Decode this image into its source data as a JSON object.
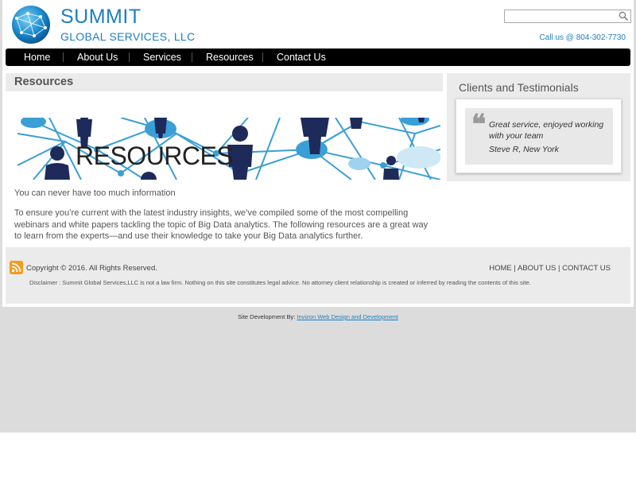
{
  "header": {
    "logo_title": "SUMMIT",
    "logo_subtitle": "GLOBAL SERVICES, LLC",
    "search_placeholder": "",
    "call_us": "Call us @ 804-302-7730"
  },
  "nav": {
    "items": [
      "Home",
      "About Us",
      "Services",
      "Resources",
      "Contact Us"
    ]
  },
  "main": {
    "title": "Resources",
    "banner_text": "RESOURCES",
    "lead": "You can never have too much information",
    "body": "To ensure you’re current with the latest industry insights, we’ve compiled some of the most compelling webinars and white papers tackling the topic of Big Data analytics. The following resources are a great way to learn from the experts—and use their knowledge to take your Big Data analytics further."
  },
  "sidebar": {
    "title": "Clients and Testimonials",
    "quote": "Great service, enjoyed working with your team",
    "author": "Steve R, New York"
  },
  "footer": {
    "copyright": "Copyright © 2016. All Rights Reserved.",
    "links": [
      "HOME",
      "ABOUT US",
      "CONTACT US"
    ],
    "disclaimer": "Disclaimer : Summit Global Services,LLC is not a law firm. Nothing on this site constitutes legal advice. No attorney client relationship is created or inferred by reading the contents of this site."
  },
  "credit": {
    "label": "Site Development By:",
    "link": "Invizon Web Design and Development"
  },
  "colors": {
    "brand_blue": "#1d7fc1",
    "nav_bg": "#000000",
    "panel_bg": "#ebebeb",
    "rss_orange": "#f39a1f",
    "figure_navy": "#1e2a5a",
    "network_blue": "#3a9fd6"
  }
}
